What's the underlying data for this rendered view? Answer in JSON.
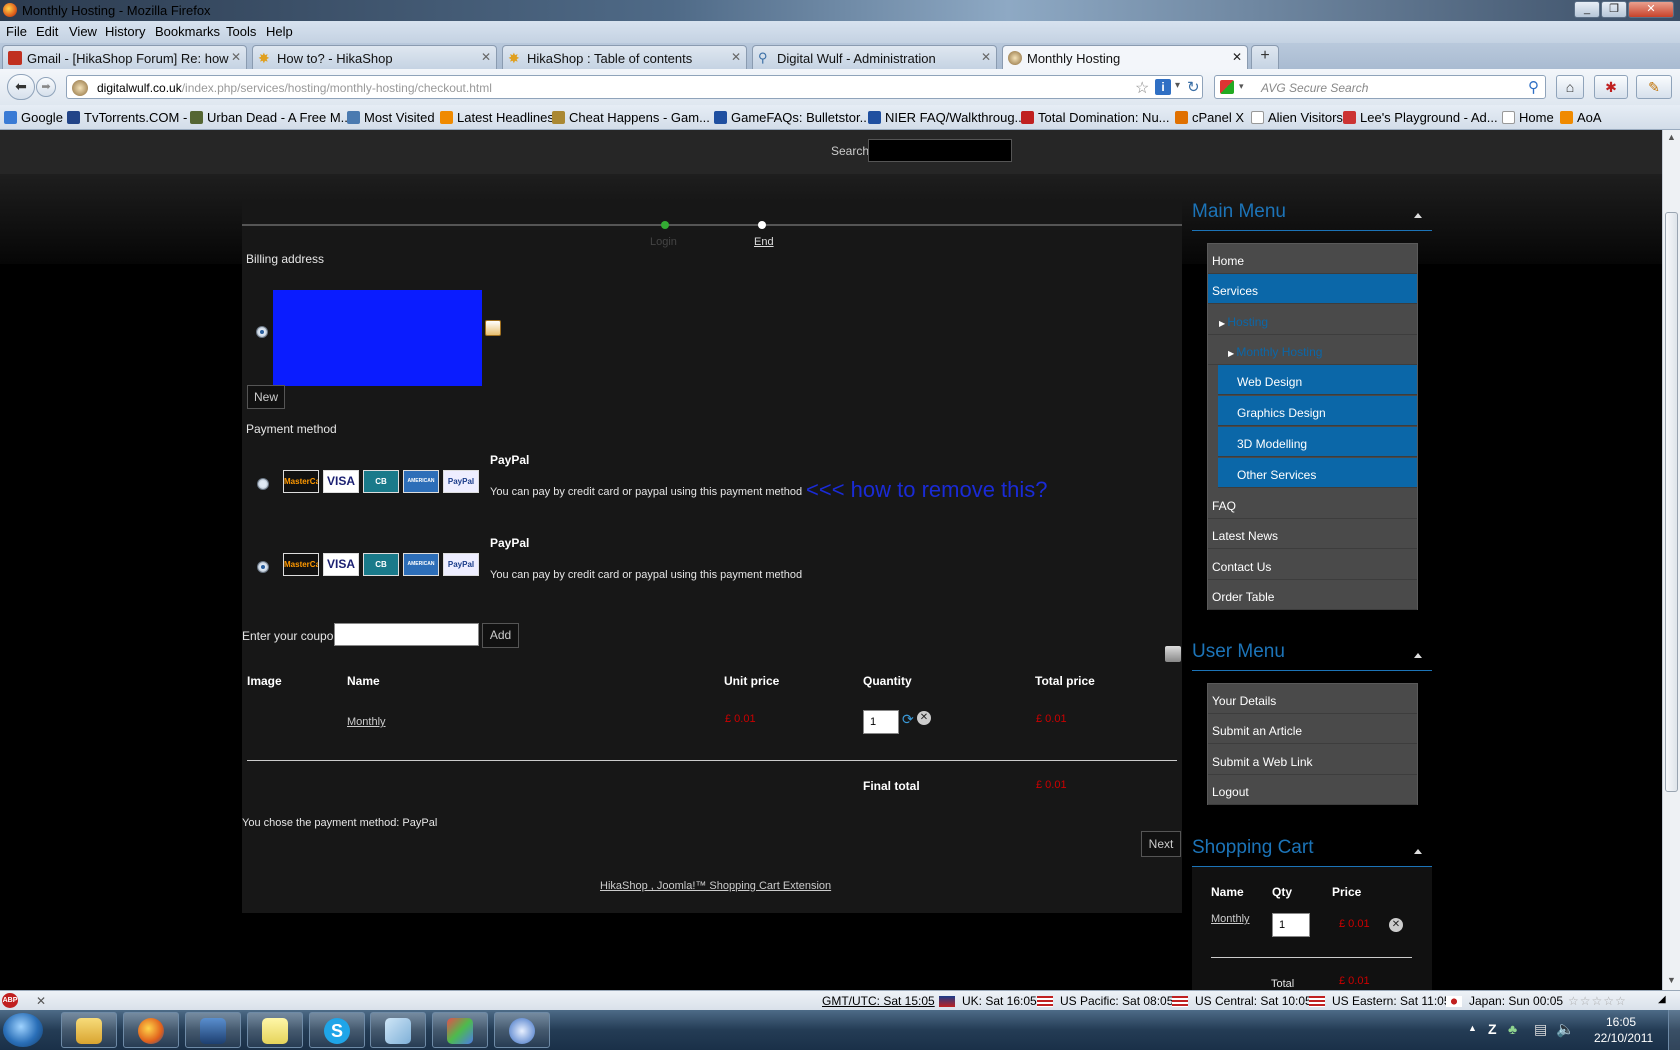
{
  "window": {
    "title": "Monthly Hosting - Mozilla Firefox"
  },
  "menubar": [
    "File",
    "Edit",
    "View",
    "History",
    "Bookmarks",
    "Tools",
    "Help"
  ],
  "tabs": [
    {
      "label": "Gmail - [HikaShop Forum] Re: how to...",
      "icon": "gmail-icon",
      "color": "#c03020"
    },
    {
      "label": "How to? - HikaShop",
      "icon": "hikashop-icon",
      "color": "#e0a020"
    },
    {
      "label": "HikaShop : Table of contents",
      "icon": "hikashop-icon",
      "color": "#e0a020"
    },
    {
      "label": "Digital Wulf - Administration",
      "icon": "search-icon",
      "color": "#3a6ea5"
    },
    {
      "label": "Monthly Hosting",
      "icon": "globe-icon",
      "color": "#8a6a3a"
    }
  ],
  "url": {
    "host": "digitalwulf.co.uk",
    "path": "/index.php/services/hosting/monthly-hosting/checkout.html"
  },
  "search": {
    "placeholder": "AVG Secure Search"
  },
  "bookmarks": [
    {
      "label": "Google",
      "color": "#3a7bd5"
    },
    {
      "label": "TvTorrents.COM -",
      "color": "#224488"
    },
    {
      "label": "Urban Dead - A Free M...",
      "color": "#556633"
    },
    {
      "label": "Most Visited",
      "color": "#4a7ab0"
    },
    {
      "label": "Latest Headlines",
      "color": "#f08a00"
    },
    {
      "label": "Cheat Happens - Gam...",
      "color": "#333333"
    },
    {
      "label": "GameFAQs: Bulletstor...",
      "color": "#1f4fa0"
    },
    {
      "label": "NIER FAQ/Walkthroug...",
      "color": "#1f4fa0"
    },
    {
      "label": "Total Domination: Nu...",
      "color": "#c02020"
    },
    {
      "label": "cPanel X",
      "color": "#e07000"
    },
    {
      "label": "Alien Visitors",
      "color": "#ffffff"
    },
    {
      "label": "Lee's Playground - Ad...",
      "color": "#cc3333"
    },
    {
      "label": "Home",
      "color": "#ffffff"
    },
    {
      "label": "AoA",
      "color": "#f08a00"
    }
  ],
  "site": {
    "search_label": "Search",
    "steps": [
      "Login",
      "End"
    ],
    "billing_label": "Billing address",
    "new_button": "New",
    "payment_label": "Payment method",
    "payments": [
      {
        "name": "PayPal",
        "desc": "You can pay by credit card or paypal using this payment method",
        "selected": false
      },
      {
        "name": "PayPal",
        "desc": "You can pay by credit card or paypal using this payment method",
        "selected": true
      }
    ],
    "annotation": "<<< how to remove this?",
    "cards": [
      "MasterCard",
      "VISA",
      "CB",
      "AMERICAN EXPRESS",
      "PayPal"
    ],
    "coupon_label": "Enter your coupon",
    "coupon_button": "Add",
    "cart_headers": [
      "Image",
      "Name",
      "Unit price",
      "Quantity",
      "Total price"
    ],
    "cart_row": {
      "name": "Monthly",
      "unit_price": "£ 0.01",
      "quantity": "1",
      "total": "£ 0.01"
    },
    "final_total_label": "Final total",
    "final_total": "£ 0.01",
    "chosen_text": "You chose the payment method: PayPal",
    "next_button": "Next",
    "footer_link": "HikaShop , Joomla!™ Shopping Cart Extension"
  },
  "sidebar": {
    "main_menu_title": "Main Menu",
    "main_menu": [
      {
        "label": "Home"
      },
      {
        "label": "Services"
      },
      {
        "label": "Hosting"
      },
      {
        "label": "Monthly Hosting"
      },
      {
        "label": "Web Design"
      },
      {
        "label": "Graphics Design"
      },
      {
        "label": "3D Modelling"
      },
      {
        "label": "Other Services"
      },
      {
        "label": "FAQ"
      },
      {
        "label": "Latest News"
      },
      {
        "label": "Contact Us"
      },
      {
        "label": "Order Table"
      }
    ],
    "user_menu_title": "User Menu",
    "user_menu": [
      {
        "label": "Your Details"
      },
      {
        "label": "Submit an Article"
      },
      {
        "label": "Submit a Web Link"
      },
      {
        "label": "Logout"
      }
    ],
    "cart_title": "Shopping Cart",
    "cart_headers": [
      "Name",
      "Qty",
      "Price"
    ],
    "cart_item": {
      "name": "Monthly",
      "qty": "1",
      "price": "£ 0.01"
    },
    "cart_total_label": "Total",
    "cart_total": "£ 0.01"
  },
  "statusbar": {
    "clocks": [
      "GMT/UTC: Sat 15:05",
      "UK: Sat 16:05",
      "US Pacific: Sat 08:05",
      "US Central: Sat 10:05",
      "US Eastern: Sat 11:05",
      "Japan: Sun 00:05"
    ],
    "adblock": "ABP"
  },
  "taskbar": {
    "time": "16:05",
    "date": "22/10/2011",
    "apps": [
      "windows-explorer",
      "firefox",
      "virtualbox",
      "sticky-notes",
      "skype",
      "notepad",
      "paint",
      "thunderbird"
    ]
  },
  "colors": {
    "accent": "#1c74b8",
    "menu_selected": "#0b67a8",
    "price": "#cc0000",
    "annotation": "#1a2bd6",
    "redacted": "#0a1cff"
  }
}
